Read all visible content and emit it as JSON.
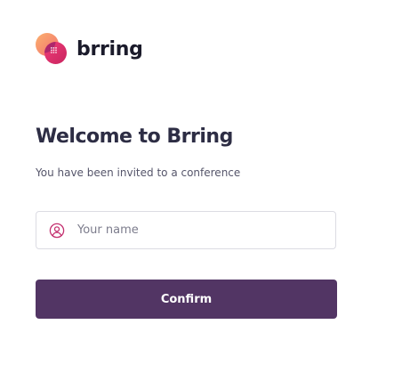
{
  "brand": {
    "logo_icon": "brring-logo-icon",
    "name": "brring",
    "colors": {
      "coral": "#f9a06a",
      "pink": "#e2336f",
      "magenta": "#a52a68",
      "text": "#1b1b2b"
    }
  },
  "welcome": {
    "title": "Welcome to Brring",
    "subtitle": "You have been invited to a conference"
  },
  "form": {
    "name_field": {
      "icon": "user-circle-icon",
      "placeholder": "Your name",
      "value": ""
    },
    "confirm_label": "Confirm"
  },
  "colors": {
    "button_background": "#523564",
    "title_text": "#2d2d44",
    "field_icon": "#c4306f"
  }
}
